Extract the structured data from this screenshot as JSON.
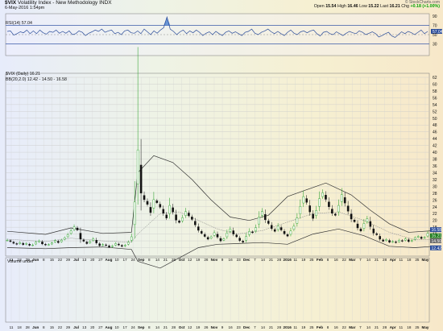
{
  "header": {
    "symbol": "$VIX",
    "name": "Volatility Index - New Methodology",
    "exchange": "INDX",
    "datetime": "6-May-2016 1:54pm",
    "credit": "© StockCharts.com",
    "open_label": "Open",
    "open": "15.54",
    "high_label": "High",
    "high": "16.46",
    "low_label": "Low",
    "low": "15.22",
    "last_label": "Last",
    "last": "16.21",
    "chg_label": "Chg",
    "chg": "+0.18 (+1.00%)"
  },
  "rsi_panel": {
    "label": "RSI(14) 57.04",
    "levels": [
      "90",
      "70",
      "57.04",
      "50",
      "30"
    ]
  },
  "price_panel": {
    "label": "$VIX (Daily) 16.21",
    "bb_label": "BB(20,2.0) 12.42 - 14.50 - 16.58",
    "y_ticks": [
      "62",
      "60",
      "58",
      "56",
      "54",
      "52",
      "50",
      "48",
      "46",
      "44",
      "42",
      "40",
      "38",
      "36",
      "34",
      "32",
      "30",
      "28",
      "26",
      "24",
      "22",
      "20",
      "18",
      "16",
      "14",
      "12"
    ],
    "right_badges": [
      "16.58",
      "16.21",
      "14.50",
      "12.42"
    ]
  },
  "volume_panel": {
    "label": "Volume undef"
  },
  "x_axis": {
    "ticks": [
      "11",
      "18",
      "28",
      "Jun",
      "8",
      "15",
      "22",
      "29",
      "Jul",
      "13",
      "20",
      "27",
      "Aug",
      "10",
      "17",
      "24",
      "Sep",
      "8",
      "14",
      "21",
      "28",
      "Oct",
      "12",
      "19",
      "26",
      "Nov",
      "9",
      "16",
      "23",
      "Dec",
      "7",
      "14",
      "21",
      "28",
      "2016",
      "11",
      "19",
      "25",
      "Feb",
      "8",
      "16",
      "22",
      "Mar",
      "7",
      "14",
      "21",
      "28",
      "Apr",
      "11",
      "18",
      "25",
      "May"
    ]
  },
  "chart_data": [
    {
      "type": "line",
      "title": "RSI(14)",
      "y_levels": [
        30,
        50,
        70
      ],
      "ylim": [
        10,
        90
      ],
      "values": [
        57,
        58,
        49,
        52,
        56,
        54,
        60,
        52,
        58,
        52,
        60,
        54,
        51,
        57,
        55,
        60,
        53,
        57,
        53,
        58,
        50,
        52,
        58,
        55,
        48,
        53,
        56,
        60,
        57,
        62,
        55,
        58,
        60,
        52,
        55,
        50,
        58,
        60,
        54,
        53,
        58,
        52,
        62,
        56,
        50,
        58,
        53,
        60,
        65,
        88,
        62,
        57,
        50,
        56,
        60,
        52,
        58,
        54,
        60,
        55,
        48,
        53,
        56,
        50,
        57,
        52,
        48,
        55,
        58,
        53,
        56,
        52,
        48,
        55,
        57,
        62,
        53,
        50,
        55,
        58,
        62,
        56,
        52,
        57,
        52,
        48,
        55,
        60,
        53,
        50,
        56,
        58,
        54,
        58,
        60,
        52,
        47,
        55,
        57,
        52,
        50,
        56,
        52,
        48,
        53,
        57,
        54,
        52,
        58,
        55,
        50,
        53,
        56,
        52,
        45,
        48,
        52,
        55,
        47,
        44,
        50,
        56,
        52,
        57,
        54,
        50,
        55,
        60,
        52,
        57
      ]
    },
    {
      "type": "line",
      "title": "$VIX (Daily)",
      "ylim": [
        10,
        62
      ],
      "close": [
        14.2,
        13.8,
        13.3,
        13.0,
        13.5,
        12.9,
        13.2,
        12.7,
        12.8,
        13.6,
        14.0,
        13.1,
        12.8,
        12.9,
        13.4,
        14.1,
        13.5,
        14.2,
        14.9,
        15.8,
        16.9,
        18.1,
        17.2,
        14.5,
        13.9,
        13.2,
        13.8,
        14.6,
        13.4,
        12.6,
        12.9,
        12.7,
        12.2,
        12.5,
        13.2,
        12.8,
        12.4,
        12.7,
        13.6,
        15.2,
        25.4,
        40.7,
        28.0,
        26.1,
        24.7,
        22.3,
        26.1,
        25.2,
        23.9,
        22.1,
        20.7,
        24.4,
        22.5,
        20.1,
        19.4,
        20.8,
        22.6,
        21.4,
        20.3,
        18.7,
        17.1,
        16.2,
        15.3,
        14.5,
        15.2,
        16.4,
        15.1,
        14.0,
        14.6,
        16.3,
        17.5,
        16.0,
        15.2,
        14.1,
        13.6,
        15.3,
        16.8,
        16.4,
        17.9,
        20.9,
        22.6,
        20.2,
        19.1,
        17.6,
        16.8,
        18.3,
        17.2,
        16.1,
        15.4,
        16.9,
        18.3,
        20.7,
        24.1,
        27.0,
        25.3,
        22.5,
        20.6,
        22.9,
        26.4,
        28.1,
        26.2,
        24.0,
        22.1,
        21.5,
        24.4,
        27.6,
        25.1,
        22.7,
        20.4,
        19.6,
        17.8,
        16.9,
        19.1,
        20.5,
        18.2,
        16.3,
        15.8,
        14.5,
        13.9,
        14.4,
        13.6,
        13.8,
        13.5,
        14.2,
        13.9,
        14.6,
        13.8,
        14.1,
        14.9,
        15.3,
        14.7,
        15.0,
        16.2
      ],
      "bb_upper_points": [
        [
          0,
          16.8
        ],
        [
          12,
          15.9
        ],
        [
          20,
          17.8
        ],
        [
          30,
          16.2
        ],
        [
          39,
          16.5
        ],
        [
          41,
          34.0
        ],
        [
          46,
          39.0
        ],
        [
          52,
          37.0
        ],
        [
          58,
          32.0
        ],
        [
          64,
          26.0
        ],
        [
          70,
          21.0
        ],
        [
          76,
          20.0
        ],
        [
          82,
          21.5
        ],
        [
          88,
          27.0
        ],
        [
          94,
          29.0
        ],
        [
          100,
          31.0
        ],
        [
          108,
          27.5
        ],
        [
          114,
          23.0
        ],
        [
          120,
          19.0
        ],
        [
          126,
          16.5
        ],
        [
          134,
          17.0
        ]
      ],
      "bb_middle_points": [
        [
          0,
          14.5
        ],
        [
          12,
          13.8
        ],
        [
          20,
          14.8
        ],
        [
          30,
          14.0
        ],
        [
          39,
          13.6
        ],
        [
          41,
          16.0
        ],
        [
          48,
          22.0
        ],
        [
          54,
          22.5
        ],
        [
          60,
          20.0
        ],
        [
          66,
          17.5
        ],
        [
          72,
          16.0
        ],
        [
          80,
          17.0
        ],
        [
          88,
          19.5
        ],
        [
          96,
          22.0
        ],
        [
          104,
          22.5
        ],
        [
          112,
          20.0
        ],
        [
          120,
          16.5
        ],
        [
          128,
          14.3
        ],
        [
          134,
          14.5
        ]
      ],
      "bb_lower_points": [
        [
          0,
          12.0
        ],
        [
          12,
          11.7
        ],
        [
          20,
          12.0
        ],
        [
          30,
          12.2
        ],
        [
          39,
          11.5
        ],
        [
          41,
          8.0
        ],
        [
          48,
          6.0
        ],
        [
          54,
          9.0
        ],
        [
          60,
          12.0
        ],
        [
          66,
          13.0
        ],
        [
          72,
          13.2
        ],
        [
          80,
          13.5
        ],
        [
          88,
          13.0
        ],
        [
          96,
          16.0
        ],
        [
          104,
          17.5
        ],
        [
          112,
          15.5
        ],
        [
          120,
          12.4
        ],
        [
          128,
          12.0
        ],
        [
          134,
          12.4
        ]
      ]
    }
  ]
}
